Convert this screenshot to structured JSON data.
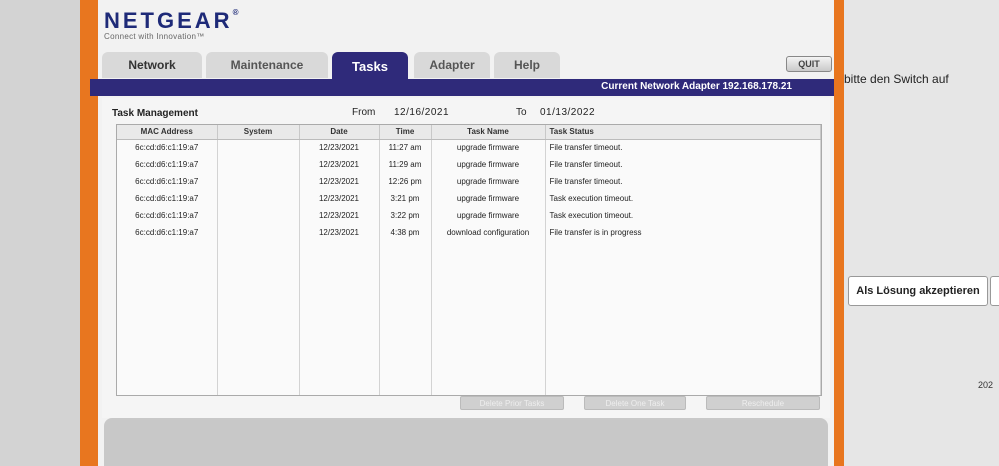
{
  "brand": {
    "logo": "NETGEAR",
    "reg": "®",
    "tagline": "Connect with Innovation™"
  },
  "tabs": [
    {
      "label": "Network"
    },
    {
      "label": "Maintenance"
    },
    {
      "label": "Tasks"
    },
    {
      "label": "Adapter"
    },
    {
      "label": "Help"
    }
  ],
  "quit_label": "QUIT",
  "adapter_info": "Current Network Adapter 192.168.178.21",
  "task_management": {
    "title": "Task Management",
    "from_label": "From",
    "from_value": "12/16/2021",
    "to_label": "To",
    "to_value": "01/13/2022",
    "columns": [
      "MAC Address",
      "System",
      "Date",
      "Time",
      "Task Name",
      "Task Status"
    ],
    "rows": [
      {
        "mac": "6c:cd:d6:c1:19:a7",
        "system": "",
        "date": "12/23/2021",
        "time": "11:27 am",
        "task": "upgrade firmware",
        "status": "File transfer timeout."
      },
      {
        "mac": "6c:cd:d6:c1:19:a7",
        "system": "",
        "date": "12/23/2021",
        "time": "11:29 am",
        "task": "upgrade firmware",
        "status": "File transfer timeout."
      },
      {
        "mac": "6c:cd:d6:c1:19:a7",
        "system": "",
        "date": "12/23/2021",
        "time": "12:26 pm",
        "task": "upgrade firmware",
        "status": "File transfer timeout."
      },
      {
        "mac": "6c:cd:d6:c1:19:a7",
        "system": "",
        "date": "12/23/2021",
        "time": "3:21 pm",
        "task": "upgrade firmware",
        "status": "Task execution timeout."
      },
      {
        "mac": "6c:cd:d6:c1:19:a7",
        "system": "",
        "date": "12/23/2021",
        "time": "3:22 pm",
        "task": "upgrade firmware",
        "status": "Task execution timeout."
      },
      {
        "mac": "6c:cd:d6:c1:19:a7",
        "system": "",
        "date": "12/23/2021",
        "time": "4:38 pm",
        "task": "download configuration",
        "status": "File transfer is in progress"
      }
    ],
    "buttons": {
      "delete_prior": "Delete Prior Tasks",
      "delete_one": "Delete One Task",
      "reschedule": "Reschedule"
    }
  },
  "background_page": {
    "text": "bitte den Switch auf",
    "accept_button": "Als Lösung akzeptieren",
    "year_fragment": "202"
  }
}
